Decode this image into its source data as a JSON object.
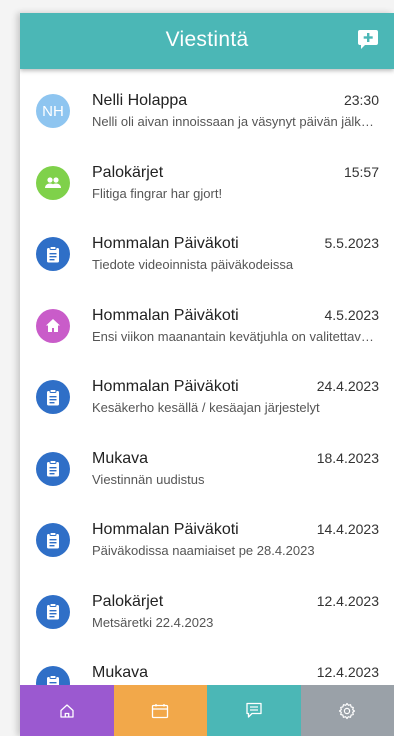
{
  "header": {
    "title": "Viestintä",
    "compose_icon": "compose-message-icon",
    "color": "#4bb7b6"
  },
  "messages": [
    {
      "sender": "Nelli Holappa",
      "time": "23:30",
      "preview": "Nelli oli aivan innoissaan ja väsynyt päivän jälkeen",
      "avatar_type": "initials",
      "avatar_text": "NH",
      "avatar_color": "#8ec5f0"
    },
    {
      "sender": "Palokärjet",
      "time": "15:57",
      "preview": "Flitiga fingrar har gjort!",
      "avatar_type": "group-icon",
      "avatar_color": "#7fd14a"
    },
    {
      "sender": "Hommalan Päiväkoti",
      "time": "5.5.2023",
      "preview": "Tiedote videoinnista päiväkodeissa",
      "avatar_type": "clipboard-icon",
      "avatar_color": "#2f6fc7"
    },
    {
      "sender": "Hommalan Päiväkoti",
      "time": "4.5.2023",
      "preview": "Ensi viikon maanantain kevätjuhla on valitettavasti siirretty",
      "avatar_type": "home-icon",
      "avatar_color": "#c95cc9"
    },
    {
      "sender": "Hommalan Päiväkoti",
      "time": "24.4.2023",
      "preview": "Kesäkerho kesällä / kesäajan järjestelyt",
      "avatar_type": "clipboard-icon",
      "avatar_color": "#2f6fc7"
    },
    {
      "sender": "Mukava",
      "time": "18.4.2023",
      "preview": "Viestinnän uudistus",
      "avatar_type": "clipboard-icon",
      "avatar_color": "#2f6fc7"
    },
    {
      "sender": "Hommalan Päiväkoti",
      "time": "14.4.2023",
      "preview": "Päiväkodissa naamiaiset pe 28.4.2023",
      "avatar_type": "clipboard-icon",
      "avatar_color": "#2f6fc7"
    },
    {
      "sender": "Palokärjet",
      "time": "12.4.2023",
      "preview": "Metsäretki 22.4.2023",
      "avatar_type": "clipboard-icon",
      "avatar_color": "#2f6fc7"
    },
    {
      "sender": "Mukava",
      "time": "12.4.2023",
      "preview": "",
      "avatar_type": "clipboard-icon",
      "avatar_color": "#2f6fc7"
    }
  ],
  "navbar": [
    {
      "name": "home",
      "icon": "home-icon",
      "color": "#9b59d0"
    },
    {
      "name": "calendar",
      "icon": "calendar-icon",
      "color": "#f2a84a"
    },
    {
      "name": "messages",
      "icon": "message-icon",
      "color": "#4bb7b6"
    },
    {
      "name": "settings",
      "icon": "settings-icon",
      "color": "#9aa1a8"
    }
  ]
}
